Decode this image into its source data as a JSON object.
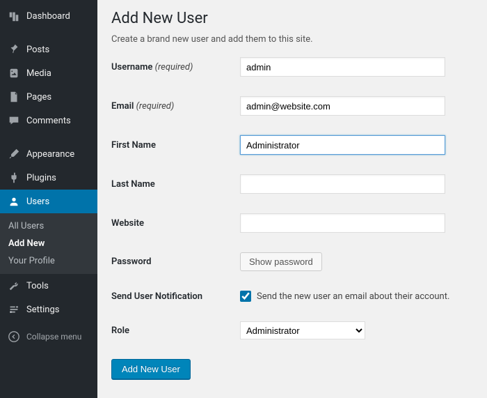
{
  "sidebar": {
    "items": [
      {
        "label": "Dashboard"
      },
      {
        "label": "Posts"
      },
      {
        "label": "Media"
      },
      {
        "label": "Pages"
      },
      {
        "label": "Comments"
      },
      {
        "label": "Appearance"
      },
      {
        "label": "Plugins"
      },
      {
        "label": "Users"
      },
      {
        "label": "Tools"
      },
      {
        "label": "Settings"
      }
    ],
    "submenu": [
      {
        "label": "All Users"
      },
      {
        "label": "Add New"
      },
      {
        "label": "Your Profile"
      }
    ],
    "collapse": "Collapse menu"
  },
  "page": {
    "title": "Add New User",
    "description": "Create a brand new user and add them to this site."
  },
  "form": {
    "username": {
      "label": "Username",
      "req": "(required)",
      "value": "admin"
    },
    "email": {
      "label": "Email",
      "req": "(required)",
      "value": "admin@website.com"
    },
    "first_name": {
      "label": "First Name",
      "value": "Administrator"
    },
    "last_name": {
      "label": "Last Name",
      "value": ""
    },
    "website": {
      "label": "Website",
      "value": ""
    },
    "password": {
      "label": "Password",
      "button": "Show password"
    },
    "notification": {
      "label": "Send User Notification",
      "text": "Send the new user an email about their account.",
      "checked": true
    },
    "role": {
      "label": "Role",
      "value": "Administrator"
    },
    "submit": "Add New User"
  }
}
